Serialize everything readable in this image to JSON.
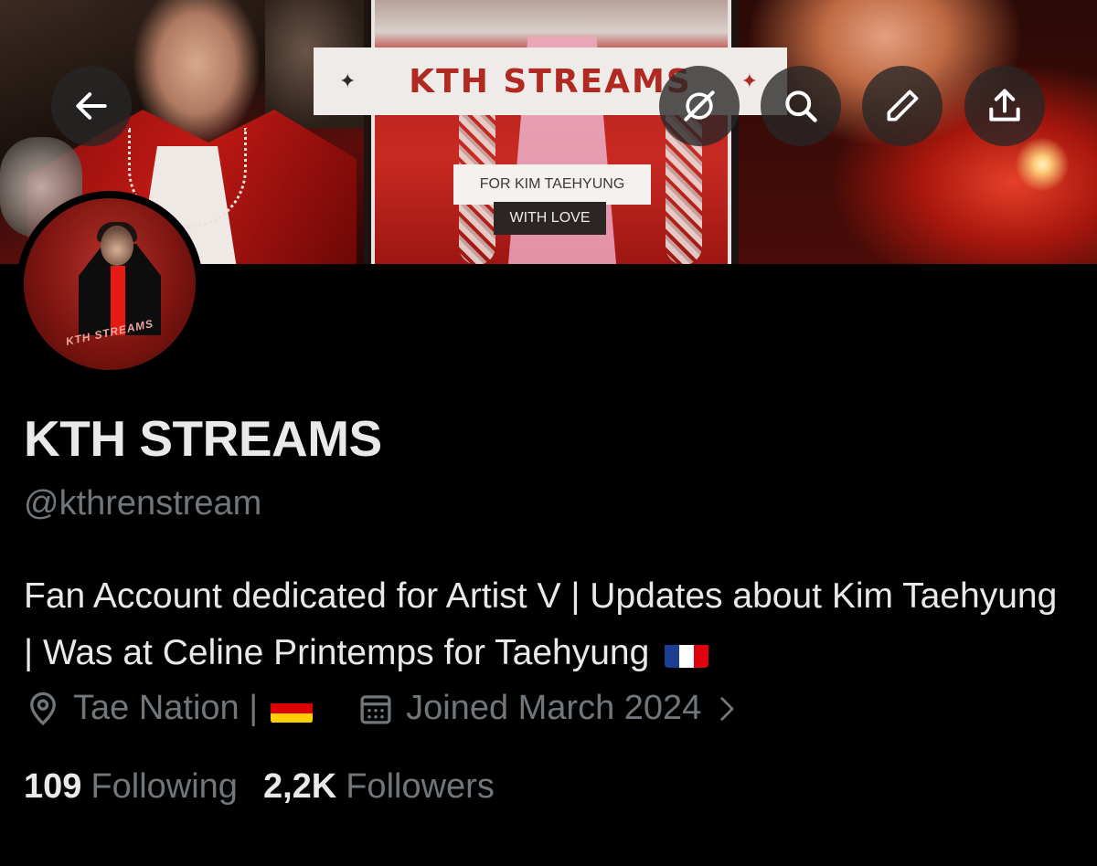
{
  "banner": {
    "title": "KTH STREAMS",
    "subtitle_line1": "FOR KIM TAEHYUNG",
    "subtitle_line2": "WITH LOVE"
  },
  "header_actions": [
    {
      "name": "back",
      "icon": "arrow-left-icon"
    },
    {
      "name": "grok",
      "icon": "grok-icon"
    },
    {
      "name": "search",
      "icon": "search-icon"
    },
    {
      "name": "edit",
      "icon": "pencil-icon"
    },
    {
      "name": "share",
      "icon": "share-icon"
    }
  ],
  "avatar": {
    "arc_text": "KTH STREAMS"
  },
  "profile": {
    "display_name": "KTH STREAMS",
    "handle": "@kthrenstream",
    "bio": "Fan Account dedicated for Artist V | Updates about Kim Taehyung | Was at Celine Printemps for Taehyung",
    "location": "Tae Nation |",
    "joined": "Joined March 2024"
  },
  "stats": {
    "following_count": "109",
    "following_label": "Following",
    "followers_count": "2,2K",
    "followers_label": "Followers"
  },
  "colors": {
    "background": "#000000",
    "primary_text": "#e7e9ea",
    "secondary_text": "#71767b",
    "banner_accent": "#b02a22"
  }
}
